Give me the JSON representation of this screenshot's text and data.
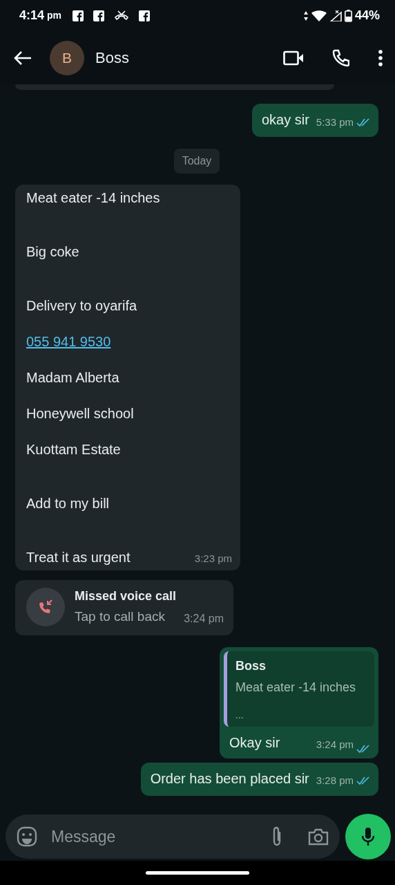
{
  "status_bar": {
    "time": "4:14",
    "ampm": "pm",
    "battery": "44%"
  },
  "header": {
    "avatar_letter": "B",
    "contact_name": "Boss"
  },
  "messages": [
    {
      "kind": "text",
      "outgoing": true,
      "text": "okay sir",
      "time": "5:33 pm",
      "read": true
    },
    {
      "kind": "date",
      "text": "Today"
    },
    {
      "kind": "multiline",
      "outgoing": false,
      "time": "3:23 pm",
      "lines": [
        {
          "text": "Meat eater -14 inches",
          "link": false
        },
        {
          "text": "Big coke",
          "link": false,
          "extra_gap": true
        },
        {
          "text": "Delivery to oyarifa",
          "link": false,
          "extra_gap": true
        },
        {
          "text": "055 941 9530",
          "link": true,
          "extra_gap": false
        },
        {
          "text": "Madam Alberta",
          "link": false,
          "extra_gap": false
        },
        {
          "text": "Honeywell school",
          "link": false,
          "extra_gap": false
        },
        {
          "text": "Kuottam Estate",
          "link": false,
          "extra_gap": false
        },
        {
          "text": "Add to my bill",
          "link": false,
          "extra_gap": true
        },
        {
          "text": "Treat it as urgent",
          "link": false,
          "extra_gap": true
        }
      ]
    },
    {
      "kind": "call",
      "outgoing": false,
      "title": "Missed voice call",
      "subtitle": "Tap to call back",
      "time": "3:24 pm"
    },
    {
      "kind": "reply",
      "outgoing": true,
      "quote_author": "Boss",
      "quote_text": "Meat eater -14 inches",
      "quote_more": "...",
      "text": "Okay sir",
      "time": "3:24 pm",
      "read": true
    },
    {
      "kind": "text",
      "outgoing": true,
      "text": "Order has been placed sir",
      "time": "3:28 pm",
      "read": true
    }
  ],
  "composer": {
    "placeholder": "Message"
  }
}
